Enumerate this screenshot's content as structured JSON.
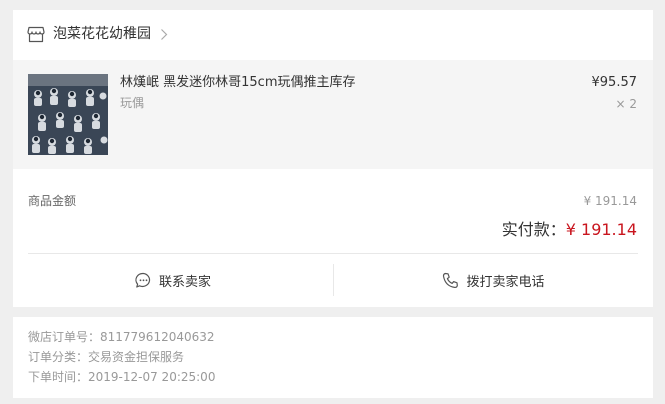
{
  "shop": {
    "name": "泡菜花花幼稚园",
    "icon": "store-icon"
  },
  "item": {
    "title": "林熯岷 黑发迷你林哥15cm玩偶推主库存",
    "category": "玩偶",
    "price": "¥95.57",
    "quantity": "× 2"
  },
  "summary": {
    "subtotal_label": "商品金额",
    "subtotal_value": "¥ 191.14",
    "paid_label": "实付款：",
    "paid_value": "¥ 191.14"
  },
  "actions": {
    "contact_label": "联系卖家",
    "call_label": "拨打卖家电话"
  },
  "order_info": {
    "order_no": "微店订单号：811779612040632",
    "category": "订单分类：交易资金担保服务",
    "time": "下单时间：2019-12-07 20:25:00"
  },
  "colors": {
    "accent": "#c9151e",
    "background": "#efefef"
  }
}
